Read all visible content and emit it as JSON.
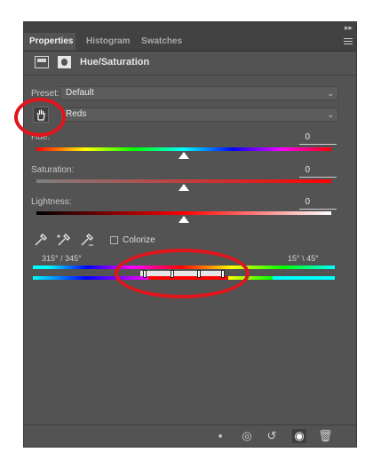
{
  "panel_tabs": [
    "Properties",
    "Histogram",
    "Swatches"
  ],
  "header": {
    "title": "Hue/Saturation"
  },
  "preset": {
    "label": "Preset:",
    "value": "Default"
  },
  "channel": {
    "value": "Reds"
  },
  "hue": {
    "label": "Hue:",
    "value": "0"
  },
  "saturation": {
    "label": "Saturation:",
    "value": "0"
  },
  "lightness": {
    "label": "Lightness:",
    "value": "0"
  },
  "colorize": {
    "label": "Colorize",
    "checked": false
  },
  "range": {
    "left": "315° / 345°",
    "right": "15° \\ 45°"
  },
  "icons": {
    "panel_menu": "menu-icon",
    "adjustment": "hue-saturation-icon",
    "mask": "mask-icon",
    "targeted_adjust": "hand-icon",
    "eyedropper": "eyedropper-icon",
    "eyedropper_add": "eyedropper-plus-icon",
    "eyedropper_sub": "eyedropper-minus-icon",
    "clip": "clip-to-layer-icon",
    "view_previous": "view-previous-icon",
    "reset": "reset-icon",
    "visibility": "eye-icon",
    "delete": "trash-icon"
  },
  "colors": {
    "panel_bg": "#535353",
    "annotation": "#e0141b"
  }
}
